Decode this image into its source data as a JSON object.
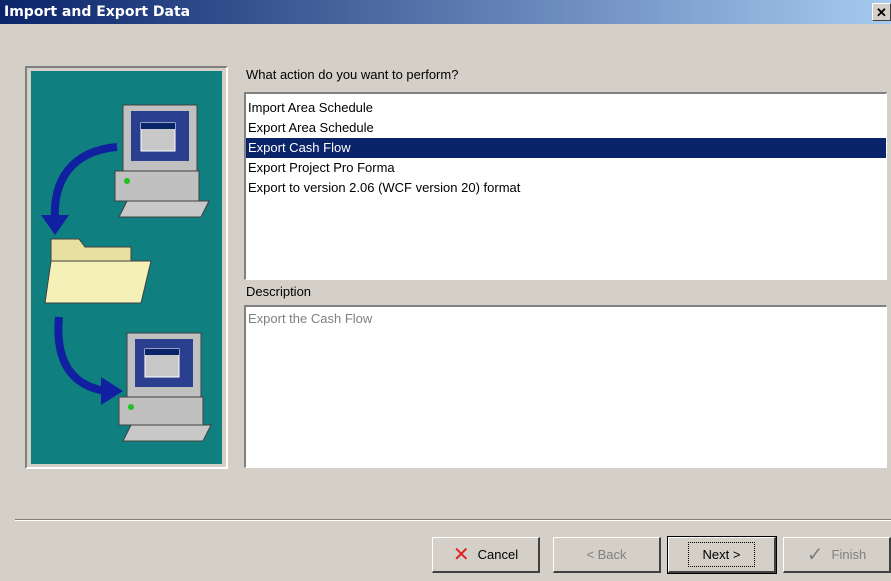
{
  "window": {
    "title": "Import and Export Data",
    "close_glyph": "✕"
  },
  "prompt": "What action do you want to perform?",
  "actions": [
    {
      "label": "Import Area Schedule",
      "selected": false
    },
    {
      "label": "Export Area Schedule",
      "selected": false
    },
    {
      "label": "Export Cash Flow",
      "selected": true
    },
    {
      "label": "Export Project Pro Forma",
      "selected": false
    },
    {
      "label": "Export to version 2.06 (WCF version 20) format",
      "selected": false
    }
  ],
  "description": {
    "label": "Description",
    "text": "Export the Cash Flow"
  },
  "buttons": {
    "cancel": {
      "label": "Cancel",
      "icon": "red-x-icon",
      "enabled": true
    },
    "back": {
      "label": "< Back",
      "enabled": false
    },
    "next": {
      "label": "Next >",
      "enabled": true,
      "default": true
    },
    "finish": {
      "label": "Finish",
      "icon": "checkmark-icon",
      "enabled": false
    }
  },
  "illustration": {
    "icons": [
      "computer-icon",
      "curved-arrow-icon",
      "folder-icon",
      "curved-arrow-icon",
      "computer-icon"
    ]
  },
  "colors": {
    "title_start": "#0a246a",
    "title_end": "#a6caf0",
    "selection": "#0a246a",
    "illustration_bg": "#0f7f7f",
    "cancel_icon": "#e02020"
  }
}
